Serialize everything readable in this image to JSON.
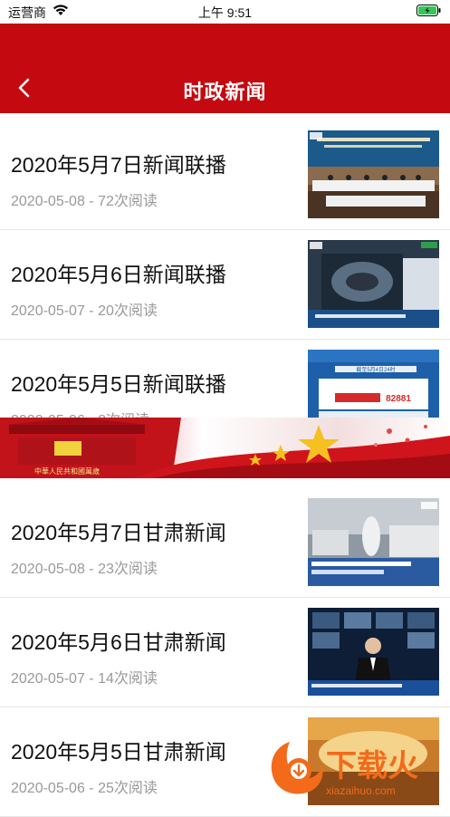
{
  "status": {
    "carrier": "运营商",
    "time": "上午 9:51"
  },
  "nav": {
    "title": "时政新闻"
  },
  "items": [
    {
      "title": "2020年5月7日新闻联播",
      "meta": "2020-05-08 - 72次阅读"
    },
    {
      "title": "2020年5月6日新闻联播",
      "meta": "2020-05-07 - 20次阅读"
    },
    {
      "title": "2020年5月5日新闻联播",
      "meta": "2020-05-06 - 8次阅读"
    },
    {
      "title": "2020年5月7日甘肃新闻",
      "meta": "2020-05-08 - 23次阅读"
    },
    {
      "title": "2020年5月6日甘肃新闻",
      "meta": "2020-05-07 - 14次阅读"
    },
    {
      "title": "2020年5月5日甘肃新闻",
      "meta": "2020-05-06 - 25次阅读"
    }
  ],
  "banner": {
    "gate_text": "中華人民共和國萬歲"
  },
  "thumbs": {
    "t3_date": "截至5月4日24时",
    "t3_count": "82881"
  },
  "watermark": {
    "text": "下载火",
    "url": "xiazaihuo.com"
  },
  "colors": {
    "brand_red": "#c40a10",
    "meta_gray": "#999999"
  }
}
